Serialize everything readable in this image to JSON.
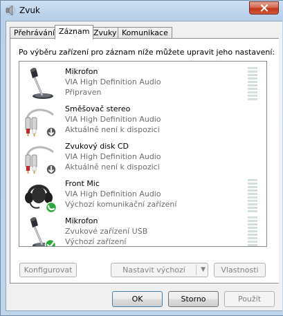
{
  "window": {
    "title": "Zvuk",
    "close_icon": "close-x-icon",
    "accent": "#c2361b"
  },
  "tabs": [
    {
      "label": "Přehrávání",
      "active": false
    },
    {
      "label": "Záznam",
      "active": true
    },
    {
      "label": "Zvuky",
      "active": false
    },
    {
      "label": "Komunikace",
      "active": false
    }
  ],
  "description": "Po výběru zařízení pro záznam níže můžete upravit jeho nastavení:",
  "devices": [
    {
      "name": "Mikrofon",
      "driver": "VIA High Definition Audio",
      "status": "Připraven",
      "icon": "microphone-icon",
      "badge": "",
      "meter": true
    },
    {
      "name": "Směšovač stereo",
      "driver": "VIA High Definition Audio",
      "status": "Aktuálně není k dispozici",
      "icon": "stereo-mix-cable-icon",
      "badge": "unavailable-down-arrow-badge",
      "meter": false
    },
    {
      "name": "Zvukový disk CD",
      "driver": "VIA High Definition Audio",
      "status": "Aktuálně není k dispozici",
      "icon": "cd-audio-cable-icon",
      "badge": "unavailable-down-arrow-badge",
      "meter": false
    },
    {
      "name": "Front Mic",
      "driver": "VIA High Definition Audio",
      "status": "Výchozí komunikační zařízení",
      "icon": "headset-icon",
      "badge": "phone-badge",
      "meter": true
    },
    {
      "name": "Mikrofon",
      "driver": "Zvukové zařízení USB",
      "status": "Výchozí zařízení",
      "icon": "microphone-icon",
      "badge": "default-checkmark-badge",
      "meter": true
    }
  ],
  "buttons": {
    "configure": "Konfigurovat",
    "set_default": "Nastavit výchozí",
    "properties": "Vlastnosti",
    "ok": "OK",
    "cancel": "Storno",
    "apply": "Použít"
  }
}
